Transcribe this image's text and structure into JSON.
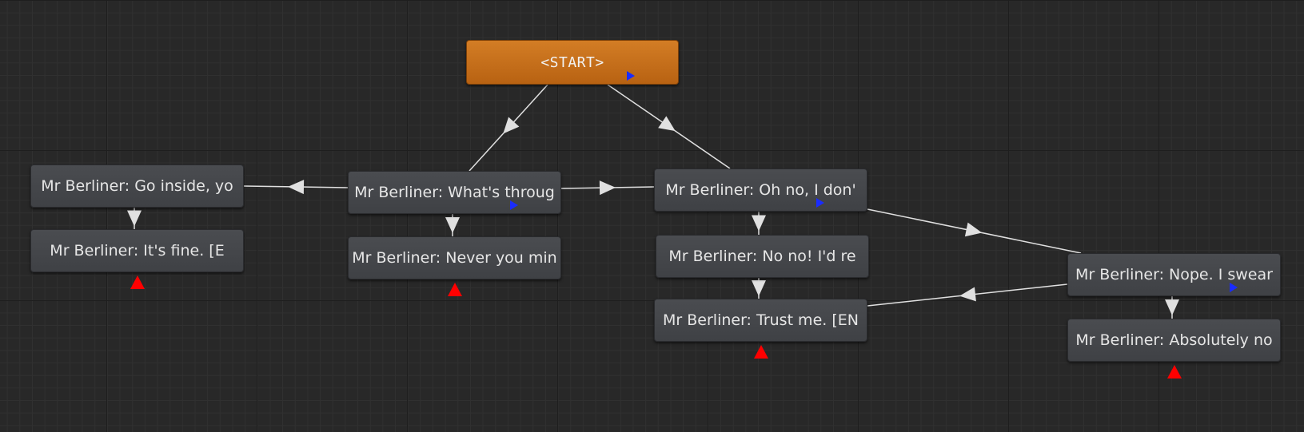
{
  "graph": {
    "nodes": [
      {
        "id": "start",
        "label": "<START>",
        "type": "start",
        "has_play": true,
        "is_end": false
      },
      {
        "id": "n_whats",
        "label": "Mr Berliner: What's throug",
        "type": "dialogue",
        "has_play": true,
        "is_end": false
      },
      {
        "id": "n_ohno",
        "label": "Mr Berliner: Oh no, I don'",
        "type": "dialogue",
        "has_play": true,
        "is_end": false
      },
      {
        "id": "n_go",
        "label": "Mr Berliner: Go inside, yo",
        "type": "dialogue",
        "has_play": false,
        "is_end": false
      },
      {
        "id": "n_fine",
        "label": "Mr Berliner: It's fine. [E",
        "type": "dialogue",
        "has_play": false,
        "is_end": true
      },
      {
        "id": "n_never",
        "label": "Mr Berliner: Never you min",
        "type": "dialogue",
        "has_play": false,
        "is_end": true
      },
      {
        "id": "n_nono",
        "label": "Mr Berliner: No no! I'd re",
        "type": "dialogue",
        "has_play": false,
        "is_end": false
      },
      {
        "id": "n_trust",
        "label": "Mr Berliner: Trust me. [EN",
        "type": "dialogue",
        "has_play": false,
        "is_end": true
      },
      {
        "id": "n_nope",
        "label": "Mr Berliner: Nope. I swear",
        "type": "dialogue",
        "has_play": true,
        "is_end": false
      },
      {
        "id": "n_abs",
        "label": "Mr Berliner: Absolutely no",
        "type": "dialogue",
        "has_play": false,
        "is_end": true
      }
    ],
    "edges": [
      {
        "from": "start",
        "to": "n_whats"
      },
      {
        "from": "start",
        "to": "n_ohno"
      },
      {
        "from": "n_whats",
        "to": "n_go"
      },
      {
        "from": "n_whats",
        "to": "n_ohno"
      },
      {
        "from": "n_whats",
        "to": "n_never"
      },
      {
        "from": "n_go",
        "to": "n_fine"
      },
      {
        "from": "n_ohno",
        "to": "n_nono"
      },
      {
        "from": "n_ohno",
        "to": "n_nope"
      },
      {
        "from": "n_nono",
        "to": "n_trust"
      },
      {
        "from": "n_nope",
        "to": "n_trust"
      },
      {
        "from": "n_nope",
        "to": "n_abs"
      }
    ]
  },
  "colors": {
    "edge": "#e0e0e0",
    "play_icon": "#1a2cff",
    "end_icon": "#ff0000"
  }
}
